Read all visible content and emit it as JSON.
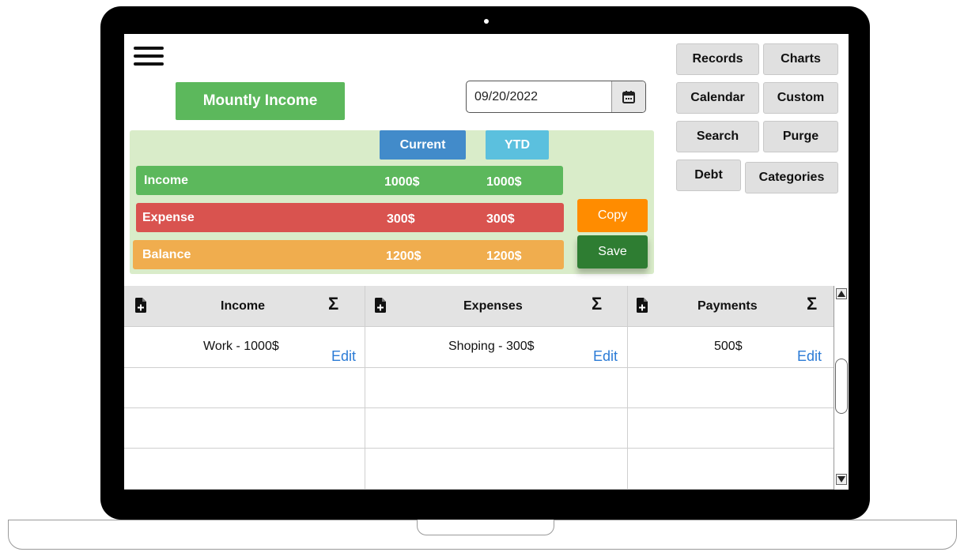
{
  "header": {
    "menu_icon": "hamburger-icon",
    "title": "Mountly Income",
    "date_value": "09/20/2022",
    "calendar_icon": "calendar-icon"
  },
  "nav": {
    "records": "Records",
    "charts": "Charts",
    "calendar": "Calendar",
    "custom": "Custom",
    "search": "Search",
    "purge": "Purge",
    "debt": "Debt",
    "categories": "Categories"
  },
  "summary": {
    "col_current": "Current",
    "col_ytd": "YTD",
    "rows": [
      {
        "label": "Income",
        "current": "1000$",
        "ytd": "1000$",
        "color": "#5cb85c"
      },
      {
        "label": "Expense",
        "current": "300$",
        "ytd": "300$",
        "color": "#d9534f"
      },
      {
        "label": "Balance",
        "current": "1200$",
        "ytd": "1200$",
        "color": "#f0ad4e"
      }
    ],
    "copy_label": "Copy",
    "save_label": "Save"
  },
  "table": {
    "columns": [
      {
        "title": "Income",
        "entry": "Work - 1000$",
        "edit": "Edit"
      },
      {
        "title": "Expenses",
        "entry": "Shoping - 300$",
        "edit": "Edit"
      },
      {
        "title": "Payments",
        "entry": "500$",
        "edit": "Edit"
      }
    ],
    "sum_symbol": "Σ",
    "add_icon": "add-file-icon"
  },
  "colors": {
    "green": "#5cb85c",
    "red": "#d9534f",
    "orange": "#f0ad4e",
    "blue": "#428bca",
    "light_blue": "#5bc0de",
    "copy": "#ff8c00",
    "save": "#2e7d32",
    "panel": "#d9ecc9"
  }
}
